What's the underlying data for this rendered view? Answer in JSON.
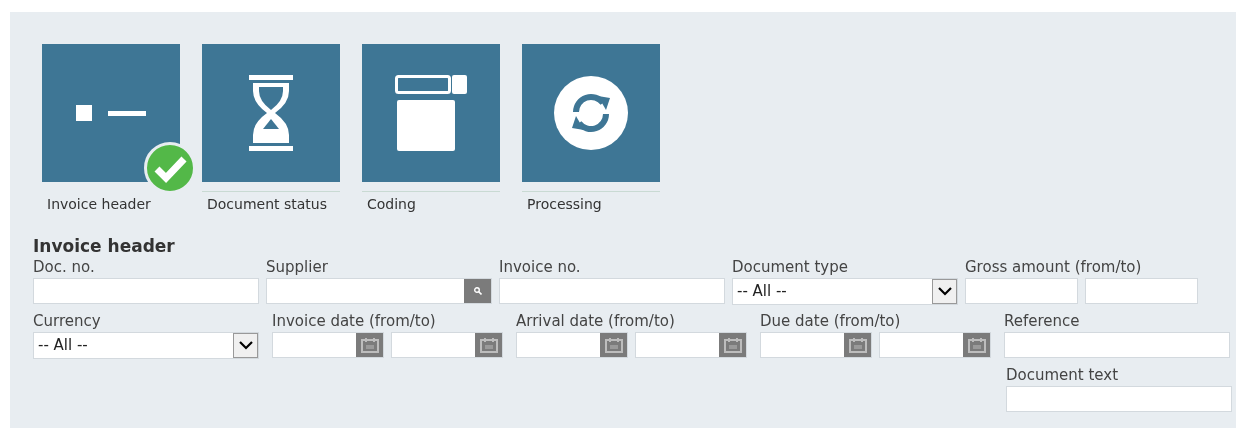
{
  "tiles": [
    {
      "label": "Invoice header",
      "completed": true
    },
    {
      "label": "Document status",
      "completed": false
    },
    {
      "label": "Coding",
      "completed": false
    },
    {
      "label": "Processing",
      "completed": false
    }
  ],
  "section_title": "Invoice header",
  "rows": [
    [
      {
        "kind": "text",
        "label": "Doc. no."
      },
      {
        "kind": "lookup",
        "label": "Supplier"
      },
      {
        "kind": "text",
        "label": "Invoice no."
      },
      {
        "kind": "select",
        "label": "Document type",
        "value": "-- All --"
      },
      {
        "kind": "range",
        "label": "Gross amount (from/to)"
      }
    ],
    [
      {
        "kind": "select",
        "label": "Currency",
        "value": "-- All --"
      },
      {
        "kind": "date_range",
        "label": "Invoice date (from/to)"
      },
      {
        "kind": "date_range",
        "label": "Arrival date (from/to)"
      },
      {
        "kind": "date_range",
        "label": "Due date (from/to)"
      },
      {
        "kind": "text",
        "label": "Reference"
      }
    ],
    [
      {
        "kind": "text",
        "label": "Document text"
      }
    ]
  ]
}
